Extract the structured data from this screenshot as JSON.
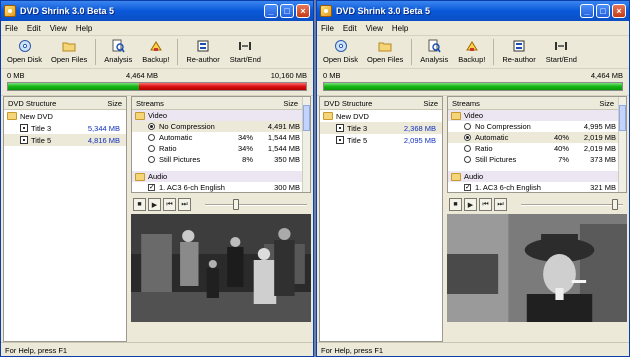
{
  "windows": [
    {
      "title": "DVD Shrink 3.0 Beta 5",
      "menu": [
        "File",
        "Edit",
        "View",
        "Help"
      ],
      "toolbar": [
        "Open Disk",
        "Open Files",
        "Analysis",
        "Backup!",
        "Re-author",
        "Start/End"
      ],
      "size_labels": {
        "left": "0 MB",
        "mid": "4,464 MB",
        "right": "10,160 MB"
      },
      "progress": {
        "fill_fraction": 0.44,
        "over_fraction": 0.56
      },
      "structure": {
        "header": "DVD Structure",
        "size_header": "Size",
        "root": "New DVD",
        "titles": [
          {
            "label": "Title 3",
            "size": "5,344 MB",
            "selected": false
          },
          {
            "label": "Title 5",
            "size": "4,816 MB",
            "selected": true
          }
        ]
      },
      "streams": {
        "header": "Streams",
        "size_header": "Size",
        "video_group": "Video",
        "options": [
          {
            "label": "No Compression",
            "pct": "",
            "size": "4,491 MB",
            "on": true
          },
          {
            "label": "Automatic",
            "pct": "34%",
            "size": "1,544 MB",
            "on": false
          },
          {
            "label": "Ratio",
            "pct": "34%",
            "size": "1,544 MB",
            "on": false
          },
          {
            "label": "Still Pictures",
            "pct": "8%",
            "size": "350 MB",
            "on": false
          }
        ],
        "audio_group": "Audio",
        "audio": [
          {
            "label": "1. AC3 6-ch English",
            "size": "300 MB",
            "checked": true
          }
        ]
      },
      "slider_position": 0.3,
      "scene": "left",
      "status": "For Help, press F1"
    },
    {
      "title": "DVD Shrink 3.0 Beta 5",
      "menu": [
        "File",
        "Edit",
        "View",
        "Help"
      ],
      "toolbar": [
        "Open Disk",
        "Open Files",
        "Analysis",
        "Backup!",
        "Re-author",
        "Start/End"
      ],
      "size_labels": {
        "left": "0 MB",
        "mid": "",
        "right": "4,464 MB"
      },
      "progress": {
        "fill_fraction": 1.0,
        "over_fraction": 0
      },
      "structure": {
        "header": "DVD Structure",
        "size_header": "Size",
        "root": "New DVD",
        "titles": [
          {
            "label": "Title 3",
            "size": "2,368 MB",
            "selected": true
          },
          {
            "label": "Title 5",
            "size": "2,095 MB",
            "selected": false
          }
        ]
      },
      "streams": {
        "header": "Streams",
        "size_header": "Size",
        "video_group": "Video",
        "options": [
          {
            "label": "No Compression",
            "pct": "",
            "size": "4,995 MB",
            "on": false
          },
          {
            "label": "Automatic",
            "pct": "40%",
            "size": "2,019 MB",
            "on": true
          },
          {
            "label": "Ratio",
            "pct": "40%",
            "size": "2,019 MB",
            "on": false
          },
          {
            "label": "Still Pictures",
            "pct": "7%",
            "size": "373 MB",
            "on": false
          }
        ],
        "audio_group": "Audio",
        "audio": [
          {
            "label": "1. AC3 6-ch English",
            "size": "321 MB",
            "checked": true
          }
        ]
      },
      "slider_position": 0.92,
      "scene": "right",
      "status": "For Help, press F1"
    }
  ]
}
